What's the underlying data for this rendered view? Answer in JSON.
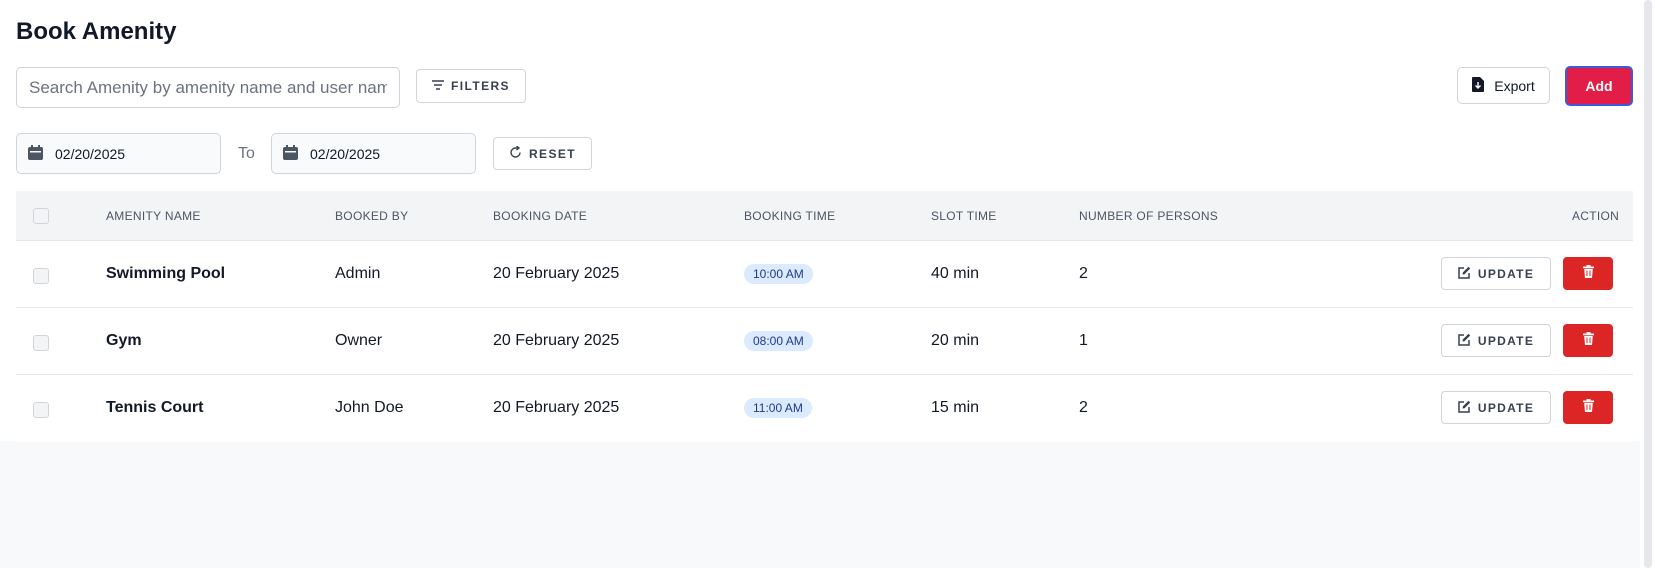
{
  "page": {
    "title": "Book Amenity"
  },
  "toolbar": {
    "search_placeholder": "Search Amenity by amenity name and user name",
    "filters_label": "FILTERS",
    "export_label": "Export",
    "add_label": "Add",
    "icons": {
      "filters": "filter-lines-icon",
      "export": "file-download-icon"
    }
  },
  "date_range": {
    "from": "02/20/2025",
    "to_label": "To",
    "to": "02/20/2025",
    "reset_label": "RESET",
    "icons": {
      "date": "calendar-icon",
      "reset": "refresh-icon"
    }
  },
  "table": {
    "columns": [
      "AMENITY NAME",
      "BOOKED BY",
      "BOOKING DATE",
      "BOOKING TIME",
      "SLOT TIME",
      "NUMBER OF PERSONS",
      "ACTION"
    ],
    "rows": [
      {
        "amenity": "Swimming Pool",
        "booked_by": "Admin",
        "date": "20 February 2025",
        "time": "10:00 AM",
        "slot": "40 min",
        "persons": "2",
        "update_label": "UPDATE"
      },
      {
        "amenity": "Gym",
        "booked_by": "Owner",
        "date": "20 February 2025",
        "time": "08:00 AM",
        "slot": "20 min",
        "persons": "1",
        "update_label": "UPDATE"
      },
      {
        "amenity": "Tennis Court",
        "booked_by": "John Doe",
        "date": "20 February 2025",
        "time": "11:00 AM",
        "slot": "15 min",
        "persons": "2",
        "update_label": "UPDATE"
      }
    ],
    "icons": {
      "update": "edit-icon",
      "delete": "trash-icon"
    }
  },
  "colors": {
    "add_button": "#e11d48",
    "delete_button": "#dc2626",
    "time_pill_bg": "#dbeafe",
    "time_pill_text": "#1e3a8a"
  }
}
